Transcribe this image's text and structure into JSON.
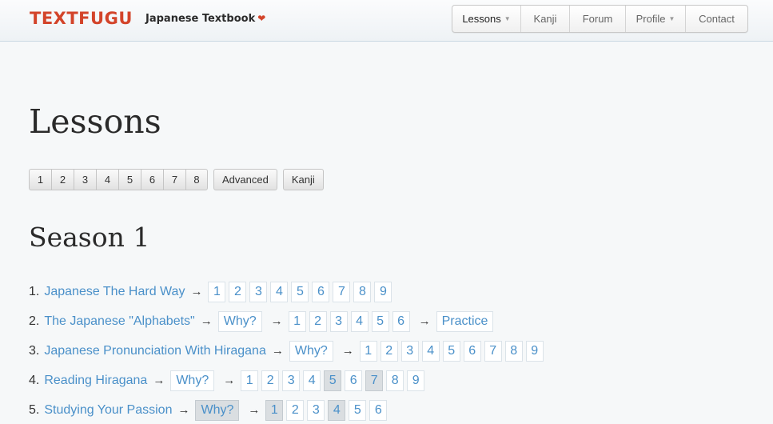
{
  "header": {
    "logo": "TEXTFUGU",
    "tagline": "Japanese Textbook",
    "heart": "❤",
    "nav": [
      {
        "label": "Lessons",
        "dropdown": true,
        "active": true,
        "width": 86
      },
      {
        "label": "Kanji",
        "dropdown": false,
        "active": false,
        "width": 61
      },
      {
        "label": "Forum",
        "dropdown": false,
        "active": false,
        "width": 70
      },
      {
        "label": "Profile",
        "dropdown": true,
        "active": false,
        "width": 75
      },
      {
        "label": "Contact",
        "dropdown": false,
        "active": false,
        "width": 77
      }
    ]
  },
  "page": {
    "title": "Lessons",
    "season_buttons": [
      "1",
      "2",
      "3",
      "4",
      "5",
      "6",
      "7",
      "8"
    ],
    "advanced_label": "Advanced",
    "kanji_label": "Kanji"
  },
  "season": {
    "title": "Season 1",
    "arrow": "→",
    "lessons": [
      {
        "number": "1.",
        "title": "Japanese The Hard Way",
        "groups": [
          [
            {
              "label": "1"
            },
            {
              "label": "2"
            },
            {
              "label": "3"
            },
            {
              "label": "4"
            },
            {
              "label": "5"
            },
            {
              "label": "6"
            },
            {
              "label": "7"
            },
            {
              "label": "8"
            },
            {
              "label": "9"
            }
          ]
        ]
      },
      {
        "number": "2.",
        "title": "The Japanese \"Alphabets\"",
        "groups": [
          [
            {
              "label": "Why?"
            }
          ],
          [
            {
              "label": "1"
            },
            {
              "label": "2"
            },
            {
              "label": "3"
            },
            {
              "label": "4"
            },
            {
              "label": "5"
            },
            {
              "label": "6"
            }
          ],
          [
            {
              "label": "Practice"
            }
          ]
        ]
      },
      {
        "number": "3.",
        "title": "Japanese Pronunciation With Hiragana",
        "groups": [
          [
            {
              "label": "Why?"
            }
          ],
          [
            {
              "label": "1"
            },
            {
              "label": "2"
            },
            {
              "label": "3"
            },
            {
              "label": "4"
            },
            {
              "label": "5"
            },
            {
              "label": "6"
            },
            {
              "label": "7"
            },
            {
              "label": "8"
            },
            {
              "label": "9"
            }
          ]
        ]
      },
      {
        "number": "4.",
        "title": "Reading Hiragana",
        "groups": [
          [
            {
              "label": "Why?"
            }
          ],
          [
            {
              "label": "1"
            },
            {
              "label": "2"
            },
            {
              "label": "3"
            },
            {
              "label": "4"
            },
            {
              "label": "5",
              "visited": true
            },
            {
              "label": "6"
            },
            {
              "label": "7",
              "visited": true
            },
            {
              "label": "8"
            },
            {
              "label": "9"
            }
          ]
        ]
      },
      {
        "number": "5.",
        "title": "Studying Your Passion",
        "groups": [
          [
            {
              "label": "Why?",
              "visited": true
            }
          ],
          [
            {
              "label": "1",
              "visited": true
            },
            {
              "label": "2"
            },
            {
              "label": "3"
            },
            {
              "label": "4",
              "visited": true
            },
            {
              "label": "5"
            },
            {
              "label": "6"
            }
          ]
        ]
      }
    ]
  },
  "colors": {
    "brand": "#d3442a",
    "link": "#4a90c9",
    "visited_bg": "#dadee1"
  }
}
